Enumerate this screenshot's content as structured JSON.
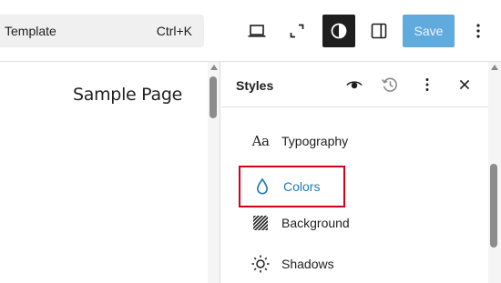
{
  "topbar": {
    "command_label": "Template",
    "command_shortcut": "Ctrl+K",
    "save_label": "Save",
    "accent_color": "#2d8ed4",
    "icons": [
      "laptop-icon",
      "expand-icon",
      "styles-icon",
      "sidebar-icon",
      "more-vertical-icon"
    ]
  },
  "canvas": {
    "page_title": "Sample Page"
  },
  "panel": {
    "title": "Styles",
    "header_icons": [
      "eye-icon",
      "revisions-icon",
      "more-vertical-icon",
      "close-icon"
    ],
    "items": [
      {
        "label": "Typography",
        "icon": "typography-icon"
      },
      {
        "label": "Colors",
        "icon": "droplet-icon",
        "highlighted": true,
        "highlight_color": "#d0021b",
        "text_color": "#1f7ab7"
      },
      {
        "label": "Background",
        "icon": "background-icon"
      },
      {
        "label": "Shadows",
        "icon": "shadow-icon"
      }
    ]
  }
}
